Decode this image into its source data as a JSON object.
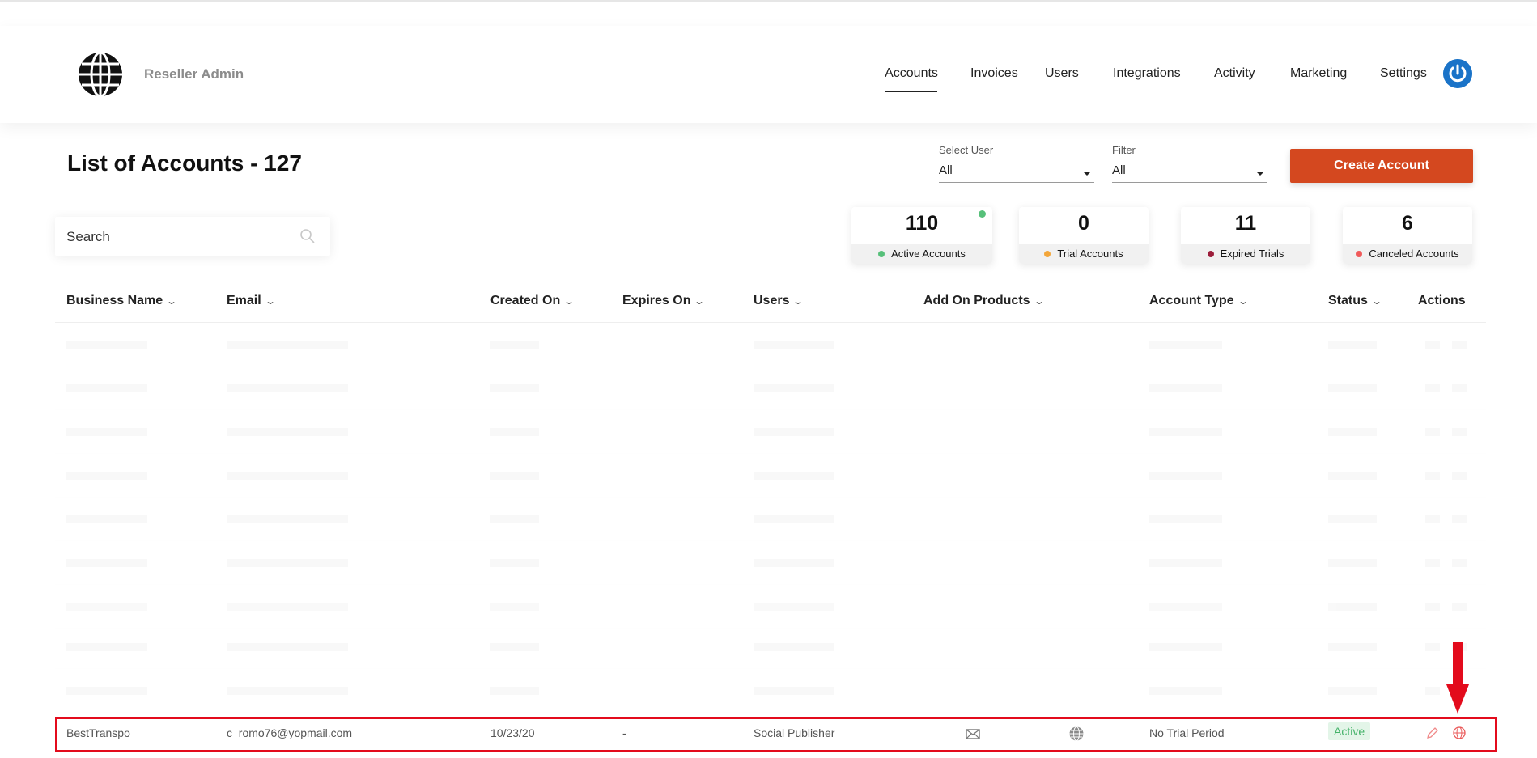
{
  "header": {
    "brand": "Reseller Admin",
    "nav": [
      {
        "label": "Accounts",
        "active": true
      },
      {
        "label": "Invoices"
      },
      {
        "label": "Users"
      },
      {
        "label": "Integrations"
      },
      {
        "label": "Activity"
      },
      {
        "label": "Marketing"
      },
      {
        "label": "Settings"
      }
    ],
    "logo_icon": "globe-icon",
    "user_icon": "power-icon"
  },
  "page": {
    "title": "List of Accounts - 127"
  },
  "filters": {
    "select_user_label": "Select User",
    "select_user_value": "All",
    "filter_label": "Filter",
    "filter_value": "All"
  },
  "actions": {
    "create_label": "Create Account",
    "accent": "#d4481f"
  },
  "search": {
    "placeholder": "Search"
  },
  "stats": [
    {
      "value": "110",
      "label": "Active Accounts",
      "color": "#57c07a"
    },
    {
      "value": "0",
      "label": "Trial Accounts",
      "color": "#f3a63a"
    },
    {
      "value": "11",
      "label": "Expired Trials",
      "color": "#9c1d3a"
    },
    {
      "value": "6",
      "label": "Canceled Accounts",
      "color": "#f05a5a"
    }
  ],
  "table": {
    "columns": [
      "Business Name",
      "Email",
      "Created On",
      "Expires On",
      "Users",
      "Add On Products",
      "Account Type",
      "Status",
      "Actions"
    ],
    "highlighted_row": {
      "business": "BestTranspo",
      "email": "c_romo76@yopmail.com",
      "created": "10/23/20",
      "expires": "-",
      "users": "Social Publisher",
      "account_type": "No Trial Period",
      "status": "Active"
    }
  },
  "colors": {
    "highlight": "#e30b1c",
    "status_green": "#46b36a"
  }
}
